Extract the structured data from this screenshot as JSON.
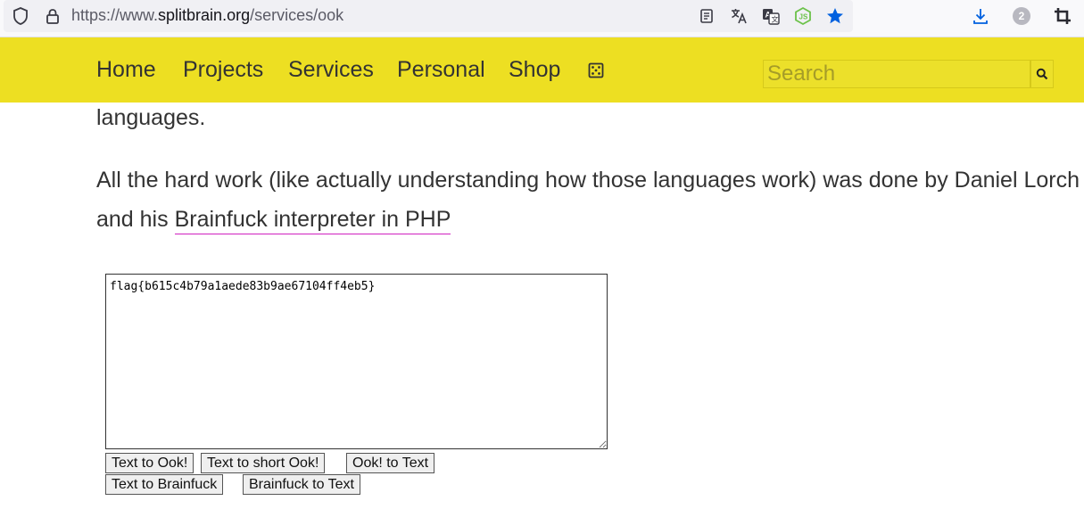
{
  "browser": {
    "url_scheme": "https://www.",
    "url_host": "splitbrain.org",
    "url_path": "/services/ook",
    "downloads_badge": "2",
    "accent_color": "#0060df"
  },
  "nav": {
    "items": [
      "Home",
      "Projects",
      "Services",
      "Personal",
      "Shop"
    ],
    "extra_icon": "dice-icon",
    "search_placeholder": "Search",
    "background_color": "#eddf22"
  },
  "content": {
    "partial_line": "languages.",
    "paragraph_line1": "All the hard work (like actually understanding how those languages work) was done by Daniel Lorch",
    "paragraph_line2_prefix": "and his ",
    "paragraph_link": "Brainfuck interpreter in PHP",
    "link_underline_color": "#d020c0"
  },
  "tool": {
    "textarea_value": "flag{b615c4b79a1aede83b9ae67104ff4eb5}",
    "buttons": {
      "text_to_ook": "Text to Ook!",
      "text_to_short_ook": "Text to short Ook!",
      "ook_to_text": "Ook! to Text",
      "text_to_brainfuck": "Text to Brainfuck",
      "brainfuck_to_text": "Brainfuck to Text"
    }
  }
}
